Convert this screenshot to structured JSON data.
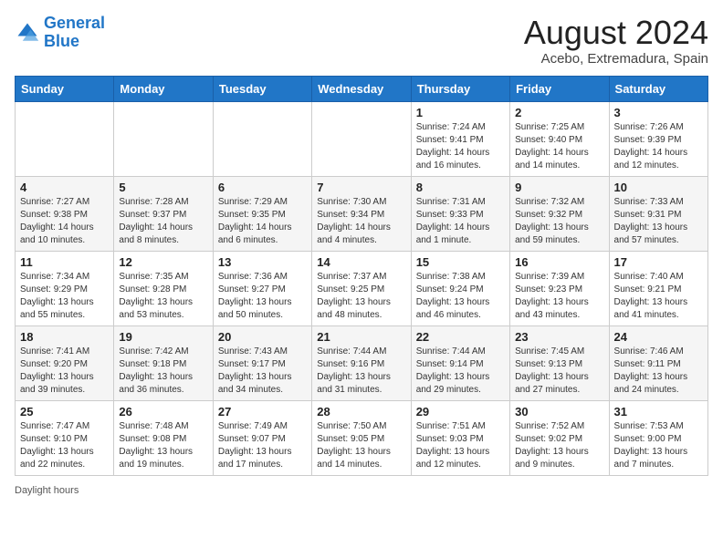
{
  "logo": {
    "line1": "General",
    "line2": "Blue"
  },
  "title": {
    "month_year": "August 2024",
    "location": "Acebo, Extremadura, Spain"
  },
  "days_of_week": [
    "Sunday",
    "Monday",
    "Tuesday",
    "Wednesday",
    "Thursday",
    "Friday",
    "Saturday"
  ],
  "footer": {
    "label": "Daylight hours"
  },
  "weeks": [
    [
      {
        "day": "",
        "info": ""
      },
      {
        "day": "",
        "info": ""
      },
      {
        "day": "",
        "info": ""
      },
      {
        "day": "",
        "info": ""
      },
      {
        "day": "1",
        "info": "Sunrise: 7:24 AM\nSunset: 9:41 PM\nDaylight: 14 hours\nand 16 minutes."
      },
      {
        "day": "2",
        "info": "Sunrise: 7:25 AM\nSunset: 9:40 PM\nDaylight: 14 hours\nand 14 minutes."
      },
      {
        "day": "3",
        "info": "Sunrise: 7:26 AM\nSunset: 9:39 PM\nDaylight: 14 hours\nand 12 minutes."
      }
    ],
    [
      {
        "day": "4",
        "info": "Sunrise: 7:27 AM\nSunset: 9:38 PM\nDaylight: 14 hours\nand 10 minutes."
      },
      {
        "day": "5",
        "info": "Sunrise: 7:28 AM\nSunset: 9:37 PM\nDaylight: 14 hours\nand 8 minutes."
      },
      {
        "day": "6",
        "info": "Sunrise: 7:29 AM\nSunset: 9:35 PM\nDaylight: 14 hours\nand 6 minutes."
      },
      {
        "day": "7",
        "info": "Sunrise: 7:30 AM\nSunset: 9:34 PM\nDaylight: 14 hours\nand 4 minutes."
      },
      {
        "day": "8",
        "info": "Sunrise: 7:31 AM\nSunset: 9:33 PM\nDaylight: 14 hours\nand 1 minute."
      },
      {
        "day": "9",
        "info": "Sunrise: 7:32 AM\nSunset: 9:32 PM\nDaylight: 13 hours\nand 59 minutes."
      },
      {
        "day": "10",
        "info": "Sunrise: 7:33 AM\nSunset: 9:31 PM\nDaylight: 13 hours\nand 57 minutes."
      }
    ],
    [
      {
        "day": "11",
        "info": "Sunrise: 7:34 AM\nSunset: 9:29 PM\nDaylight: 13 hours\nand 55 minutes."
      },
      {
        "day": "12",
        "info": "Sunrise: 7:35 AM\nSunset: 9:28 PM\nDaylight: 13 hours\nand 53 minutes."
      },
      {
        "day": "13",
        "info": "Sunrise: 7:36 AM\nSunset: 9:27 PM\nDaylight: 13 hours\nand 50 minutes."
      },
      {
        "day": "14",
        "info": "Sunrise: 7:37 AM\nSunset: 9:25 PM\nDaylight: 13 hours\nand 48 minutes."
      },
      {
        "day": "15",
        "info": "Sunrise: 7:38 AM\nSunset: 9:24 PM\nDaylight: 13 hours\nand 46 minutes."
      },
      {
        "day": "16",
        "info": "Sunrise: 7:39 AM\nSunset: 9:23 PM\nDaylight: 13 hours\nand 43 minutes."
      },
      {
        "day": "17",
        "info": "Sunrise: 7:40 AM\nSunset: 9:21 PM\nDaylight: 13 hours\nand 41 minutes."
      }
    ],
    [
      {
        "day": "18",
        "info": "Sunrise: 7:41 AM\nSunset: 9:20 PM\nDaylight: 13 hours\nand 39 minutes."
      },
      {
        "day": "19",
        "info": "Sunrise: 7:42 AM\nSunset: 9:18 PM\nDaylight: 13 hours\nand 36 minutes."
      },
      {
        "day": "20",
        "info": "Sunrise: 7:43 AM\nSunset: 9:17 PM\nDaylight: 13 hours\nand 34 minutes."
      },
      {
        "day": "21",
        "info": "Sunrise: 7:44 AM\nSunset: 9:16 PM\nDaylight: 13 hours\nand 31 minutes."
      },
      {
        "day": "22",
        "info": "Sunrise: 7:44 AM\nSunset: 9:14 PM\nDaylight: 13 hours\nand 29 minutes."
      },
      {
        "day": "23",
        "info": "Sunrise: 7:45 AM\nSunset: 9:13 PM\nDaylight: 13 hours\nand 27 minutes."
      },
      {
        "day": "24",
        "info": "Sunrise: 7:46 AM\nSunset: 9:11 PM\nDaylight: 13 hours\nand 24 minutes."
      }
    ],
    [
      {
        "day": "25",
        "info": "Sunrise: 7:47 AM\nSunset: 9:10 PM\nDaylight: 13 hours\nand 22 minutes."
      },
      {
        "day": "26",
        "info": "Sunrise: 7:48 AM\nSunset: 9:08 PM\nDaylight: 13 hours\nand 19 minutes."
      },
      {
        "day": "27",
        "info": "Sunrise: 7:49 AM\nSunset: 9:07 PM\nDaylight: 13 hours\nand 17 minutes."
      },
      {
        "day": "28",
        "info": "Sunrise: 7:50 AM\nSunset: 9:05 PM\nDaylight: 13 hours\nand 14 minutes."
      },
      {
        "day": "29",
        "info": "Sunrise: 7:51 AM\nSunset: 9:03 PM\nDaylight: 13 hours\nand 12 minutes."
      },
      {
        "day": "30",
        "info": "Sunrise: 7:52 AM\nSunset: 9:02 PM\nDaylight: 13 hours\nand 9 minutes."
      },
      {
        "day": "31",
        "info": "Sunrise: 7:53 AM\nSunset: 9:00 PM\nDaylight: 13 hours\nand 7 minutes."
      }
    ]
  ]
}
